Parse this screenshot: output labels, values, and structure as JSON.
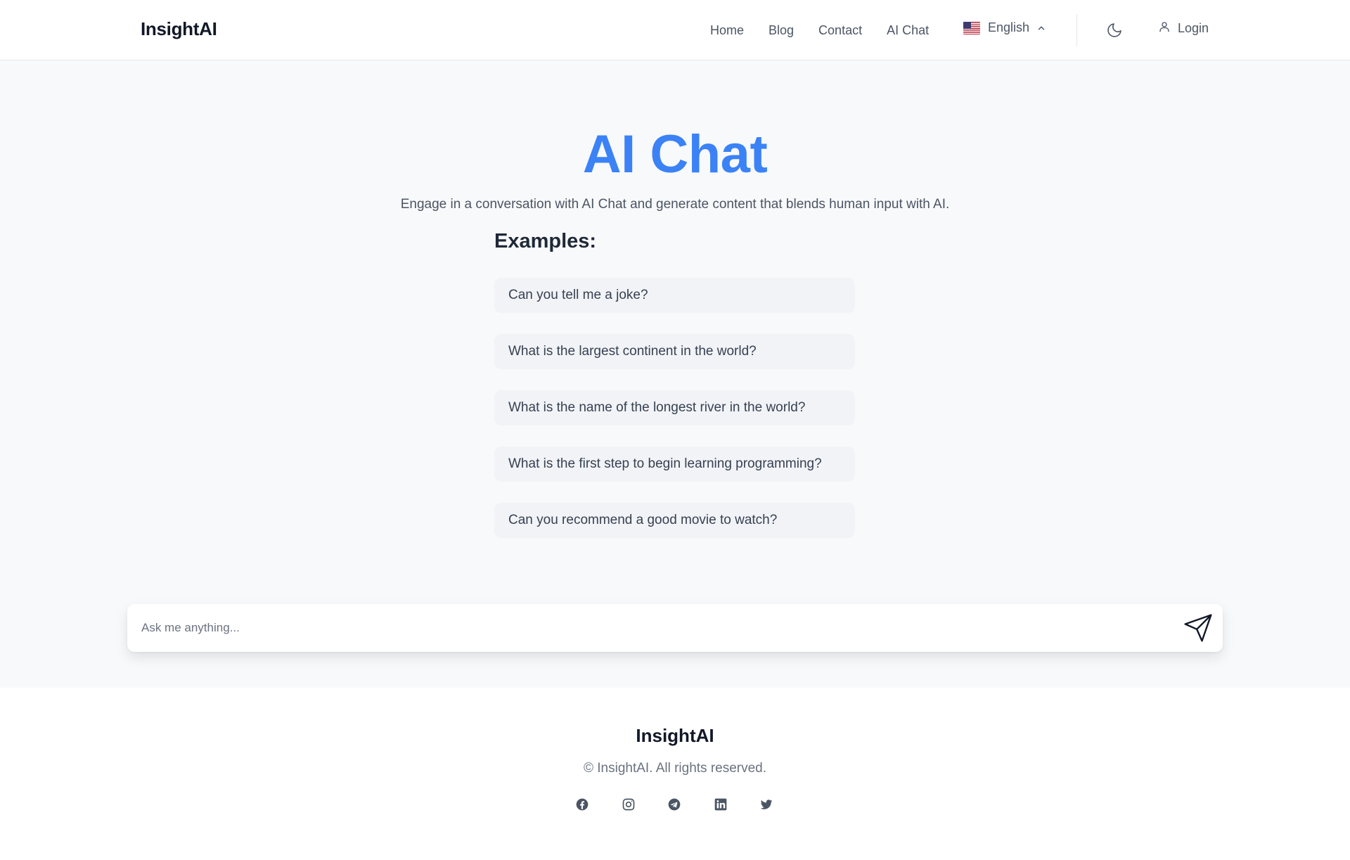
{
  "header": {
    "logo": "InsightAI",
    "nav": [
      {
        "label": "Home"
      },
      {
        "label": "Blog"
      },
      {
        "label": "Contact"
      },
      {
        "label": "AI Chat"
      }
    ],
    "language": {
      "label": "English",
      "flag_icon": "us-flag-icon"
    },
    "theme_icon": "moon-icon",
    "login_label": "Login"
  },
  "main": {
    "title": "AI Chat",
    "subtitle": "Engage in a conversation with AI Chat and generate content that blends human input with AI.",
    "examples_heading": "Examples:",
    "examples": [
      {
        "text": "Can you tell me a joke?"
      },
      {
        "text": "What is the largest continent in the world?"
      },
      {
        "text": "What is the name of the longest river in the world?"
      },
      {
        "text": "What is the first step to begin learning programming?"
      },
      {
        "text": "Can you recommend a good movie to watch?"
      }
    ],
    "chat_input": {
      "placeholder": "Ask me anything...",
      "value": ""
    },
    "send_icon": "send-icon"
  },
  "footer": {
    "logo": "InsightAI",
    "copyright": "© InsightAI. All rights reserved.",
    "socials": [
      "facebook-icon",
      "instagram-icon",
      "telegram-icon",
      "linkedin-icon",
      "twitter-icon"
    ]
  },
  "colors": {
    "accent": "#3b82f6",
    "page_bg": "#f8f9fb",
    "example_bg": "#f1f3f7",
    "text_muted": "#4b5563"
  }
}
